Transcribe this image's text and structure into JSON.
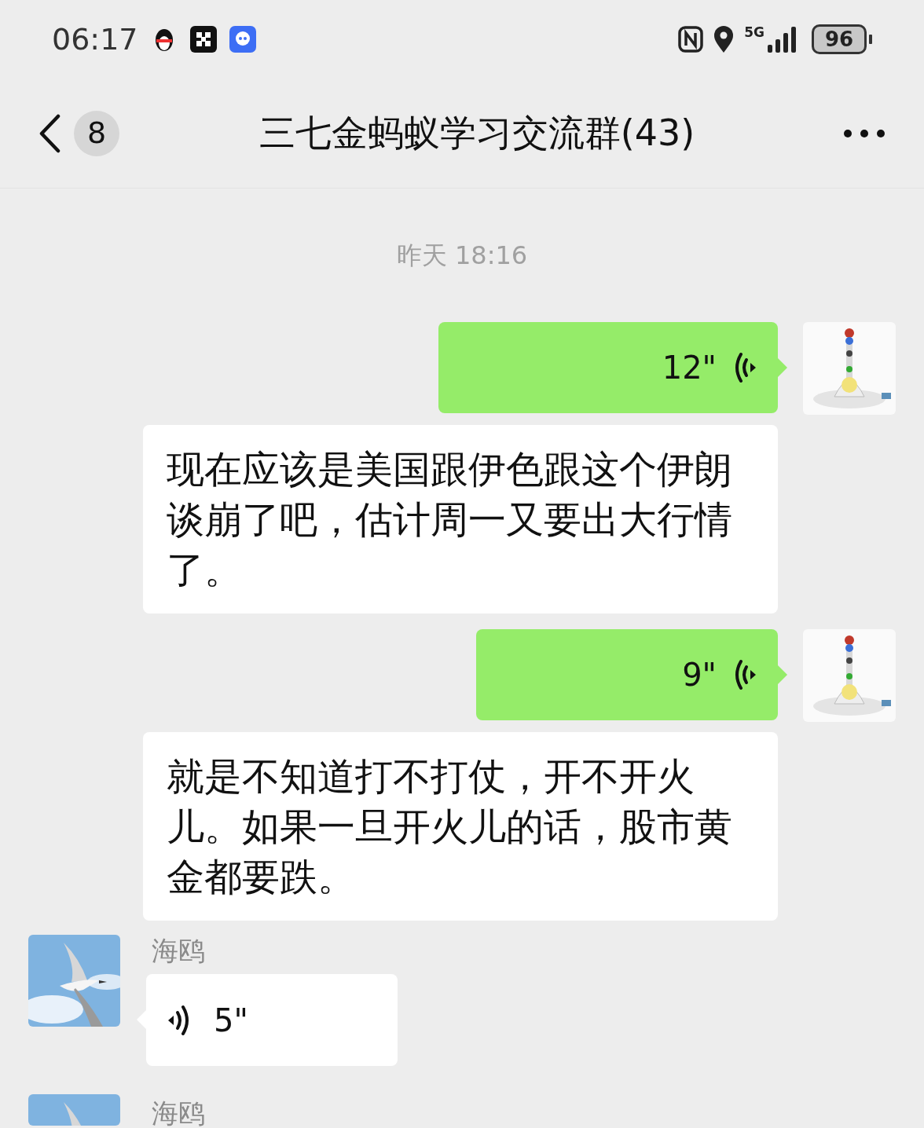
{
  "status_bar": {
    "time": "06:17",
    "network": "5G",
    "battery": "96"
  },
  "header": {
    "unread": "8",
    "title": "三七金蚂蚁学习交流群(43)"
  },
  "timestamp": "昨天 18:16",
  "messages": [
    {
      "kind": "voice_out",
      "duration": "12\""
    },
    {
      "kind": "text",
      "text": "现在应该是美国跟伊色跟这个伊朗谈崩了吧，估计周一又要出大行情了。"
    },
    {
      "kind": "voice_out",
      "duration": "9\""
    },
    {
      "kind": "text",
      "text": "就是不知道打不打仗，开不开火儿。如果一旦开火儿的话，股市黄金都要跌。"
    },
    {
      "kind": "voice_in",
      "sender": "海鸥",
      "duration": "5\""
    },
    {
      "kind": "name_only",
      "sender": "海鸥"
    }
  ]
}
